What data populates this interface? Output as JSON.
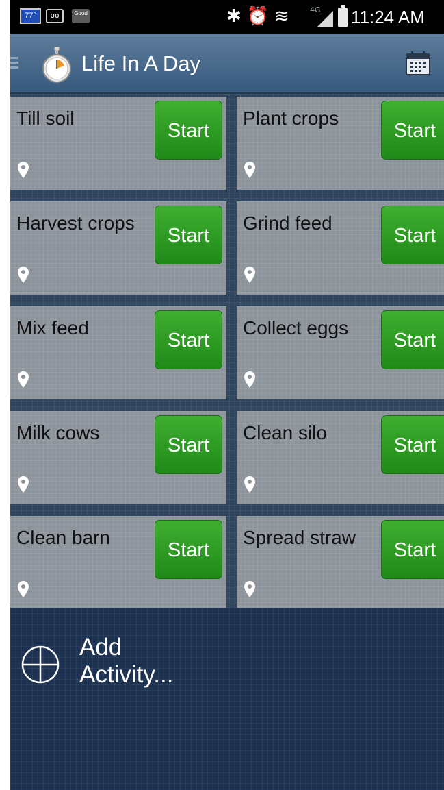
{
  "status_bar": {
    "temperature": "77°",
    "voicemail": "oo",
    "weather_badge": "Good",
    "lte": "4G",
    "time": "11:24 AM",
    "icons": [
      "bluetooth-icon",
      "alarm-icon",
      "wifi-icon",
      "signal-icon",
      "battery-icon"
    ]
  },
  "action_bar": {
    "title": "Life In A Day"
  },
  "activities": [
    {
      "name": "Till soil",
      "button": "Start"
    },
    {
      "name": "Plant crops",
      "button": "Start"
    },
    {
      "name": "Harvest crops",
      "button": "Start"
    },
    {
      "name": "Grind feed",
      "button": "Start"
    },
    {
      "name": "Mix feed",
      "button": "Start"
    },
    {
      "name": "Collect eggs",
      "button": "Start"
    },
    {
      "name": "Milk cows",
      "button": "Start"
    },
    {
      "name": "Clean silo",
      "button": "Start"
    },
    {
      "name": "Clean barn",
      "button": "Start"
    },
    {
      "name": "Spread straw",
      "button": "Start"
    }
  ],
  "add_activity": {
    "label_line1": "Add",
    "label_line2": "Activity..."
  },
  "colors": {
    "start_button": "#2a9a22",
    "tile": "#8e949c",
    "background": "#1f3350",
    "action_bar": "#4a6a8c"
  }
}
